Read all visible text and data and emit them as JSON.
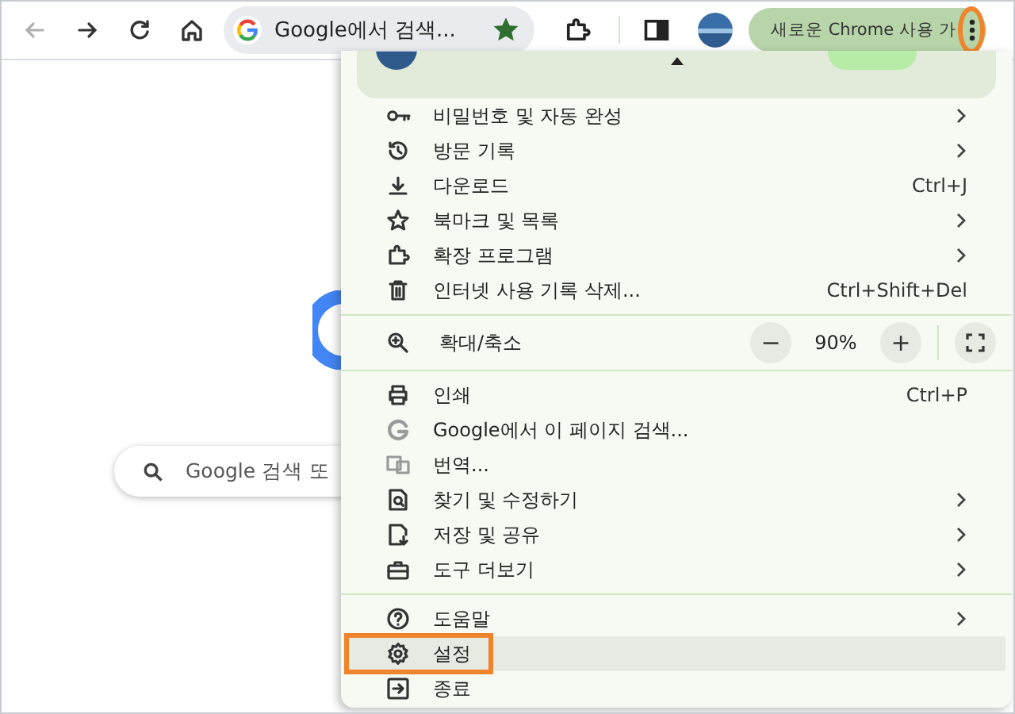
{
  "toolbar": {
    "back": {
      "disabled": true
    },
    "forward": {
      "disabled": false
    },
    "address": "Google에서 검색...",
    "bookmarked": true,
    "update_chip": "새로운 Chrome 사용 가",
    "menu_button": {
      "annotated": true
    }
  },
  "page": {
    "search_placeholder": "Google 검색 또"
  },
  "menu": {
    "sections": [
      [
        {
          "label": "비밀번호 및 자동 완성",
          "submenu": true,
          "highlighted": false,
          "annotated": false
        },
        {
          "label": "방문 기록",
          "submenu": true,
          "highlighted": false,
          "annotated": false
        },
        {
          "label": "다운로드",
          "shortcut": "Ctrl+J",
          "submenu": false,
          "highlighted": false,
          "annotated": false
        },
        {
          "label": "북마크 및 목록",
          "submenu": true,
          "highlighted": false,
          "annotated": false
        },
        {
          "label": "확장 프로그램",
          "submenu": true,
          "highlighted": false,
          "annotated": false
        },
        {
          "label": "인터넷 사용 기록 삭제...",
          "shortcut": "Ctrl+Shift+Del",
          "submenu": false,
          "highlighted": false,
          "annotated": false
        }
      ],
      [
        {
          "label": "인쇄",
          "shortcut": "Ctrl+P",
          "submenu": false,
          "highlighted": false,
          "annotated": false
        },
        {
          "label": "Google에서 이 페이지 검색...",
          "submenu": false,
          "highlighted": false,
          "annotated": false
        },
        {
          "label": "번역...",
          "submenu": false,
          "highlighted": false,
          "annotated": false
        },
        {
          "label": "찾기 및 수정하기",
          "submenu": true,
          "highlighted": false,
          "annotated": false
        },
        {
          "label": "저장 및 공유",
          "submenu": true,
          "highlighted": false,
          "annotated": false
        },
        {
          "label": "도구 더보기",
          "submenu": true,
          "highlighted": false,
          "annotated": false
        }
      ],
      [
        {
          "label": "도움말",
          "submenu": true,
          "highlighted": false,
          "annotated": false
        },
        {
          "label": "설정",
          "submenu": false,
          "highlighted": true,
          "annotated": true
        },
        {
          "label": "종료",
          "submenu": false,
          "highlighted": false,
          "annotated": false
        }
      ]
    ],
    "zoom": {
      "label": "확대/축소",
      "minus": "−",
      "value": "90%",
      "plus": "+"
    }
  }
}
